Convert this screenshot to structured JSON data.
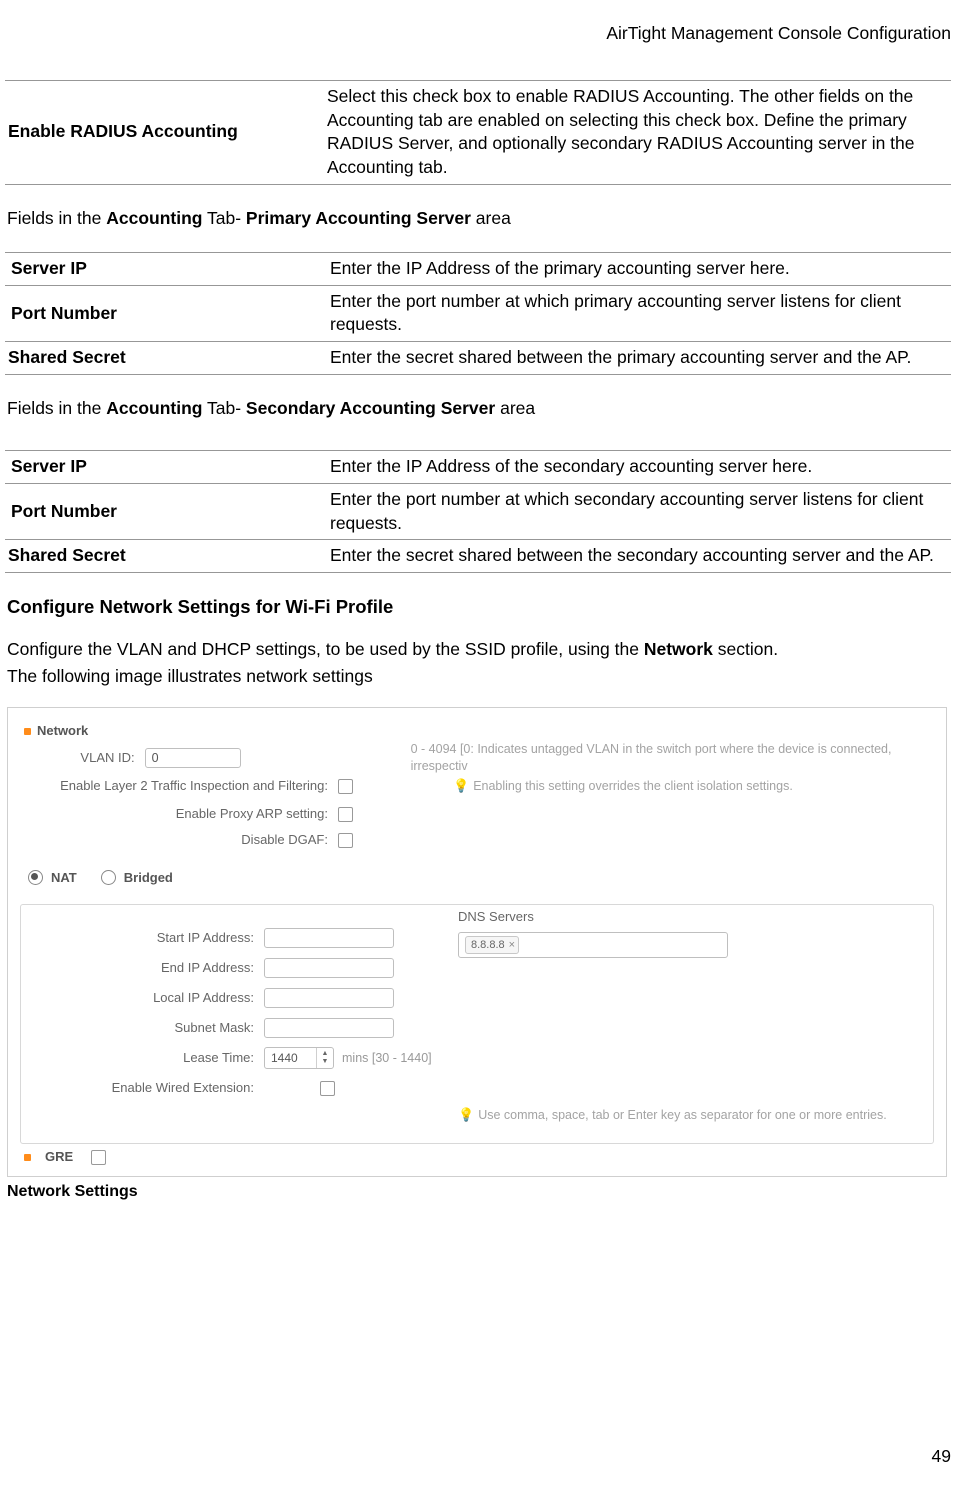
{
  "header": {
    "title": "AirTight Management Console Configuration"
  },
  "page_number": "49",
  "table_radius": {
    "rows": [
      {
        "name": "Enable RADIUS Accounting",
        "desc": "Select this check box to enable RADIUS Accounting. The other fields on the Accounting tab are enabled on selecting this check box. Define the primary RADIUS Server, and optionally secondary RADIUS Accounting server in the Accounting tab."
      }
    ]
  },
  "sec_primary": {
    "pre": "Fields in the ",
    "b1": "Accounting",
    "mid": " Tab- ",
    "b2": "Primary Accounting Server",
    "post": " area"
  },
  "table_primary": {
    "rows": [
      {
        "name": "Server IP",
        "desc": "Enter the IP Address of the primary accounting server here."
      },
      {
        "name": "Port Number",
        "desc": "Enter the port number at which primary accounting server listens for client requests."
      },
      {
        "name": "Shared Secret",
        "desc": "Enter the secret shared between the primary accounting server and the AP."
      }
    ]
  },
  "sec_secondary": {
    "pre": "Fields in the ",
    "b1": "Accounting",
    "mid": " Tab- ",
    "b2": "Secondary Accounting Server",
    "post": " area"
  },
  "table_secondary": {
    "rows": [
      {
        "name": "Server IP",
        "desc": "Enter the IP Address of the secondary accounting server here."
      },
      {
        "name": "Port Number",
        "desc": "Enter the port number at which secondary accounting server listens for client requests."
      },
      {
        "name": "Shared Secret",
        "desc": "Enter the secret shared between the secondary accounting server and the AP."
      }
    ]
  },
  "heading_network": "Configure Network Settings for Wi-Fi Profile",
  "para1_pre": "Configure the VLAN and DHCP settings, to be used by the SSID profile, using the ",
  "para1_b": "Network",
  "para1_post": " section.",
  "para2": "The following image illustrates network settings",
  "fig": {
    "section": "Network",
    "vlan_label": "VLAN ID:",
    "vlan_value": "0",
    "vlan_hint": "0 - 4094 [0: Indicates untagged VLAN in the switch port where the device is connected, irrespectiv",
    "l2_label": "Enable Layer 2 Traffic Inspection and Filtering:",
    "l2_hint": "Enabling this setting overrides the client isolation settings.",
    "proxy_label": "Enable Proxy ARP setting:",
    "dgaf_label": "Disable DGAF:",
    "nat_label": "NAT",
    "bridged_label": "Bridged",
    "start_ip": "Start IP Address:",
    "end_ip": "End IP Address:",
    "local_ip": "Local IP Address:",
    "subnet": "Subnet Mask:",
    "lease": "Lease Time:",
    "lease_value": "1440",
    "lease_hint": "mins [30 - 1440]",
    "wired": "Enable Wired Extension:",
    "dns_title": "DNS Servers",
    "dns_tag": "8.8.8.8",
    "dns_hint": "Use comma, space, tab or Enter key as separator for one or more entries.",
    "gre": "GRE"
  },
  "caption": "Network Settings"
}
